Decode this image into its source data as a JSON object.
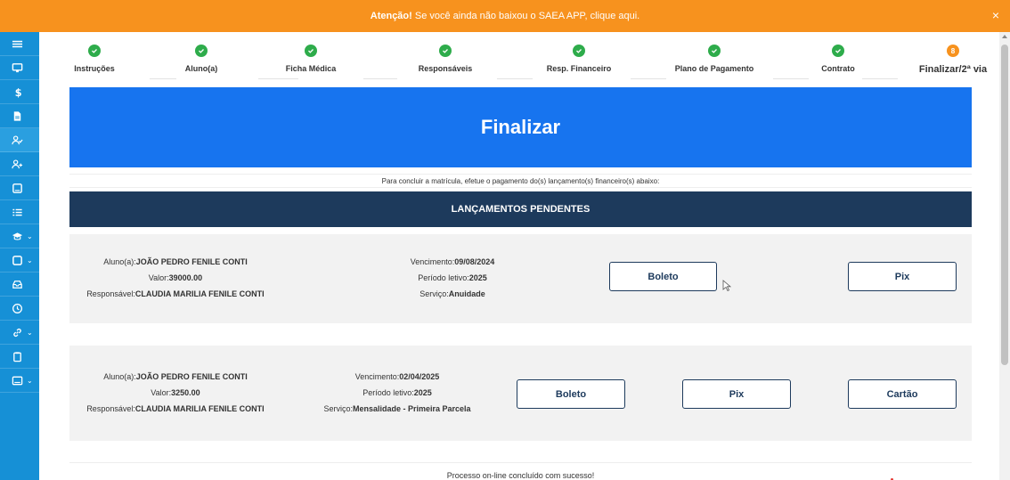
{
  "banner": {
    "bold": "Atenção!",
    "text": " Se você ainda não baixou o SAEA APP, clique aqui.",
    "close": "×"
  },
  "steps": [
    {
      "label": "Instruções",
      "status": "done"
    },
    {
      "label": "Aluno(a)",
      "status": "done"
    },
    {
      "label": "Ficha Médica",
      "status": "done"
    },
    {
      "label": "Responsáveis",
      "status": "done"
    },
    {
      "label": "Resp. Financeiro",
      "status": "done"
    },
    {
      "label": "Plano de Pagamento",
      "status": "done"
    },
    {
      "label": "Contrato",
      "status": "done"
    },
    {
      "label": "Finalizar/2ª via",
      "status": "current",
      "number": "8"
    }
  ],
  "hero_title": "Finalizar",
  "instruction": "Para concluir a matrícula, efetue o pagamento do(s) lançamento(s) financeiro(s) abaixo:",
  "pending_title": "LANÇAMENTOS PENDENTES",
  "labels": {
    "aluno": "Aluno(a):",
    "valor": "Valor:",
    "responsavel": "Responsável:",
    "vencimento": "Vencimento:",
    "periodo": "Período letivo:",
    "servico": "Serviço:"
  },
  "entries": [
    {
      "aluno": "JOÃO PEDRO FENILE CONTI",
      "valor": "39000.00",
      "responsavel": "CLAUDIA MARILIA FENILE CONTI",
      "vencimento": "09/08/2024",
      "periodo": "2025",
      "servico": "Anuidade",
      "buttons": [
        "Boleto",
        "Pix"
      ]
    },
    {
      "aluno": "JOÃO PEDRO FENILE CONTI",
      "valor": "3250.00",
      "responsavel": "CLAUDIA MARILIA FENILE CONTI",
      "vencimento": "02/04/2025",
      "periodo": "2025",
      "servico": "Mensalidade - Primeira Parcela",
      "buttons": [
        "Boleto",
        "Pix",
        "Cartão"
      ]
    }
  ],
  "footer": "Processo on-line concluído com sucesso!",
  "colors": {
    "banner": "#f7921e",
    "sidebar": "#1690d6",
    "hero": "#1774ef",
    "header": "#1d3a5c",
    "done": "#2eac4b"
  },
  "sidebar_icons": [
    "menu-icon",
    "monitor-icon",
    "dollar-icon",
    "document-icon",
    "user-check-icon",
    "user-plus-icon",
    "tablet-icon",
    "list-icon",
    "graduation-cap-icon",
    "square-icon",
    "inbox-icon",
    "clock-icon",
    "link-icon",
    "clipboard-icon",
    "window-icon"
  ]
}
